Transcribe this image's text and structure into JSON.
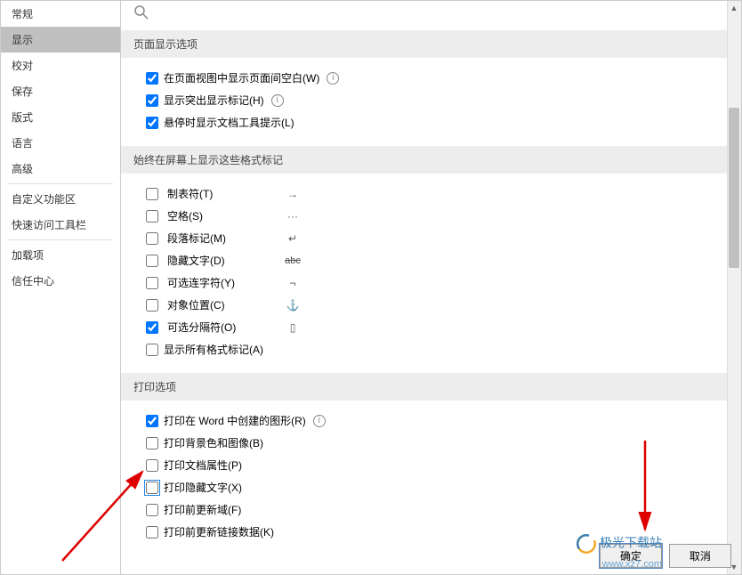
{
  "sidebar": {
    "items": [
      {
        "label": "常规"
      },
      {
        "label": "显示"
      },
      {
        "label": "校对"
      },
      {
        "label": "保存"
      },
      {
        "label": "版式"
      },
      {
        "label": "语言"
      },
      {
        "label": "高级"
      },
      {
        "label": "自定义功能区"
      },
      {
        "label": "快速访问工具栏"
      },
      {
        "label": "加载项"
      },
      {
        "label": "信任中心"
      }
    ]
  },
  "sections": {
    "page_display": {
      "title": "页面显示选项",
      "opt1": "在页面视图中显示页面间空白(W)",
      "opt2": "显示突出显示标记(H)",
      "opt3": "悬停时显示文档工具提示(L)"
    },
    "format_marks": {
      "title": "始终在屏幕上显示这些格式标记",
      "tab": "制表符(T)",
      "space": "空格(S)",
      "para": "段落标记(M)",
      "hidden": "隐藏文字(D)",
      "hyphen": "可选连字符(Y)",
      "anchor": "对象位置(C)",
      "break": "可选分隔符(O)",
      "all": "显示所有格式标记(A)"
    },
    "print": {
      "title": "打印选项",
      "opt1": "打印在 Word 中创建的图形(R)",
      "opt2": "打印背景色和图像(B)",
      "opt3": "打印文档属性(P)",
      "opt4": "打印隐藏文字(X)",
      "opt5": "打印前更新域(F)",
      "opt6": "打印前更新链接数据(K)"
    }
  },
  "symbols": {
    "tab": "→",
    "space": "···",
    "para": "↵",
    "hidden": "abc",
    "hyphen": "¬",
    "anchor": "⚓",
    "break": "▯"
  },
  "footer": {
    "ok": "确定",
    "cancel": "取消"
  },
  "watermark": {
    "name": "极光下载站",
    "url": "www.xz7.com"
  }
}
